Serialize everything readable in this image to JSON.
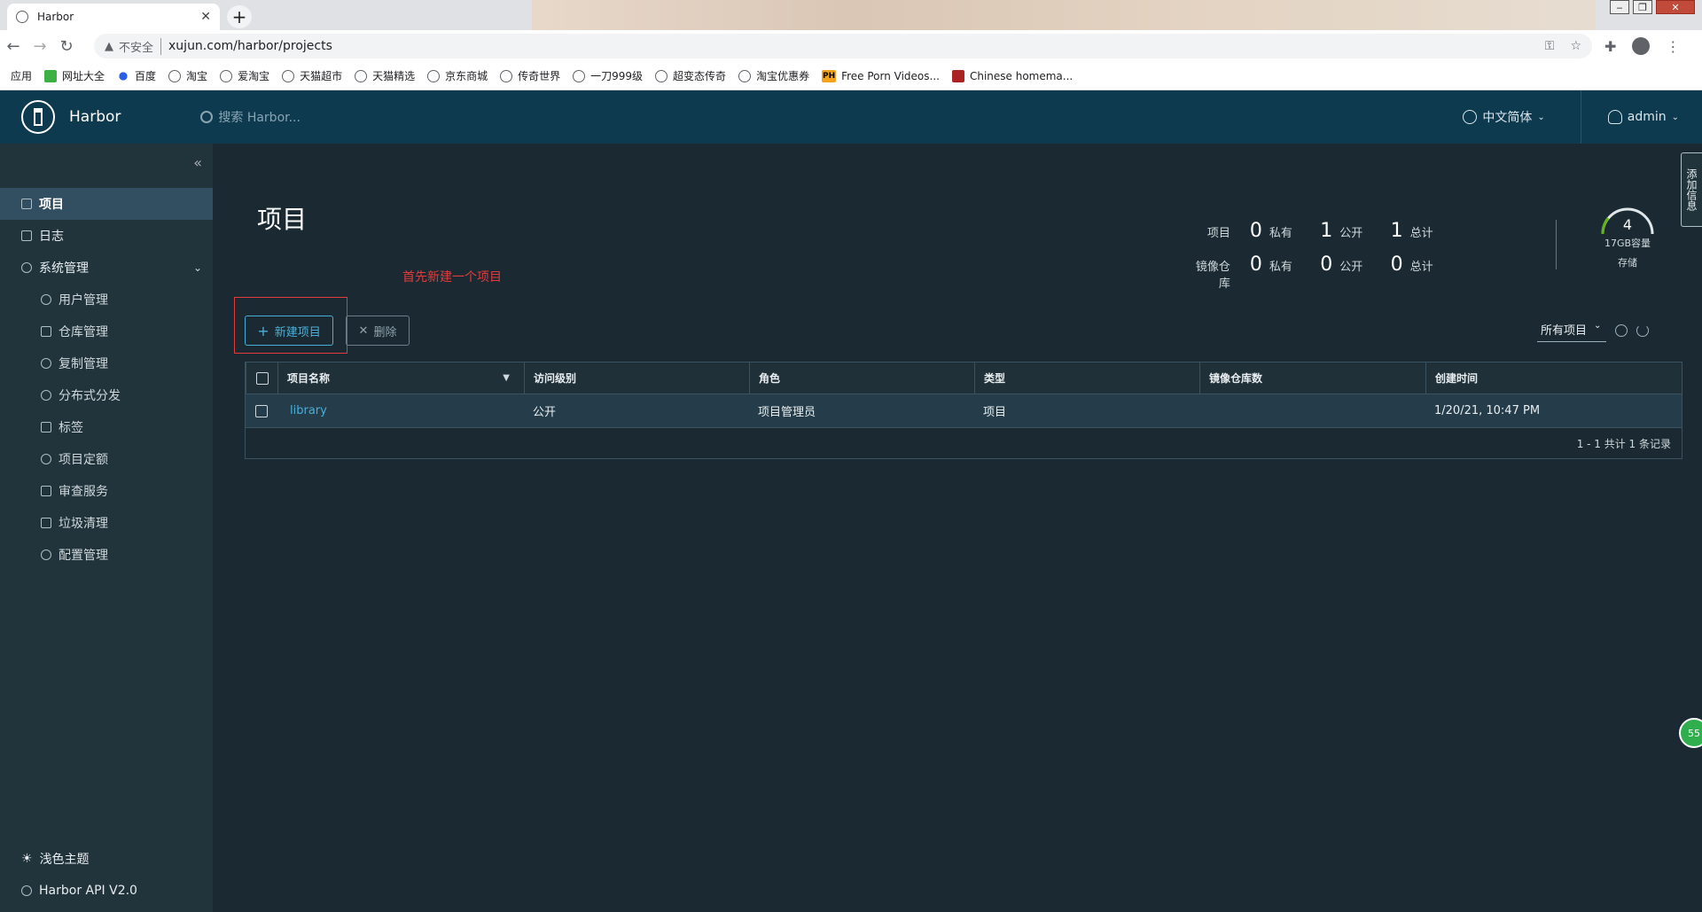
{
  "browser": {
    "tab_title": "Harbor",
    "tab_close": "✕",
    "new_tab": "+",
    "window_controls": [
      "‒",
      "❐",
      "✕"
    ],
    "insecure_label": "不安全",
    "url": "xujun.com/harbor/projects",
    "bookmarks": [
      "应用",
      "网址大全",
      "百度",
      "淘宝",
      "爱淘宝",
      "天猫超市",
      "天猫精选",
      "京东商城",
      "传奇世界",
      "一刀999级",
      "超变态传奇",
      "淘宝优惠券",
      "Free Porn Videos...",
      "Chinese homema..."
    ]
  },
  "header": {
    "brand": "Harbor",
    "search_placeholder": "搜索 Harbor...",
    "language": "中文简体",
    "user": "admin"
  },
  "sidebar": {
    "collapse_icon": "«",
    "items": [
      {
        "label": "项目"
      },
      {
        "label": "日志"
      },
      {
        "label": "系统管理"
      },
      {
        "label": "用户管理"
      },
      {
        "label": "仓库管理"
      },
      {
        "label": "复制管理"
      },
      {
        "label": "分布式分发"
      },
      {
        "label": "标签"
      },
      {
        "label": "项目定额"
      },
      {
        "label": "审查服务"
      },
      {
        "label": "垃圾清理"
      },
      {
        "label": "配置管理"
      }
    ],
    "theme": "浅色主题",
    "api": "Harbor API V2.0"
  },
  "main": {
    "title": "项目",
    "annotation": "首先新建一个项目",
    "stats": {
      "projects_label": "项目",
      "repos_label": "镜像仓库",
      "private_label": "私有",
      "public_label": "公开",
      "total_label": "总计",
      "projects": {
        "private": "0",
        "public": "1",
        "total": "1"
      },
      "repos": {
        "private": "0",
        "public": "0",
        "total": "0"
      }
    },
    "storage": {
      "value": "4",
      "capacity": "17GB容量",
      "label": "存储"
    },
    "new_button": "新建项目",
    "delete_button": "删除",
    "filter_select": "所有项目",
    "table": {
      "columns": [
        "项目名称",
        "访问级别",
        "角色",
        "类型",
        "镜像仓库数",
        "创建时间"
      ],
      "rows": [
        {
          "name": "library",
          "access": "公开",
          "role": "项目管理员",
          "type": "项目",
          "repo_count": "",
          "created": "1/20/21, 10:47 PM"
        }
      ],
      "footer": "1 - 1 共计 1 条记录"
    }
  },
  "edge_tab": "添加信息",
  "float_badge": "55"
}
